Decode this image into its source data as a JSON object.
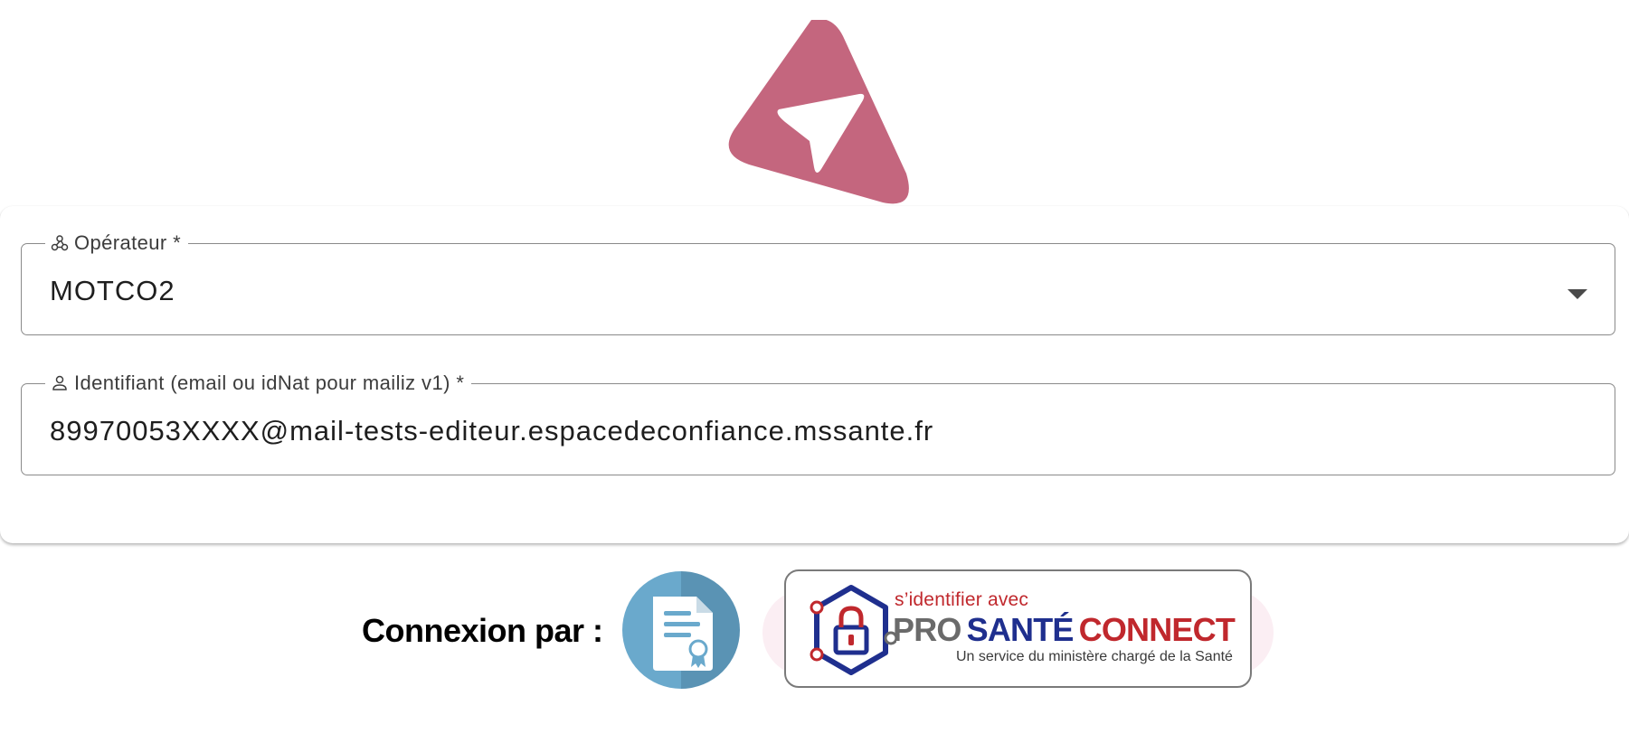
{
  "colors": {
    "brand_pink": "#c4667e",
    "field_border": "#8a8a8a",
    "cert_blue": "#6aa9cc",
    "psc_red": "#c0282d",
    "psc_navy": "#1f2f8e"
  },
  "form": {
    "operator": {
      "label": "Opérateur *",
      "icon": "webhook-icon",
      "value": "MOTCO2"
    },
    "identifier": {
      "label": "Identifiant (email ou idNat pour mailiz v1) *",
      "icon": "person-icon",
      "value": "89970053XXXX@mail-tests-editeur.espacedeconfiance.mssante.fr"
    }
  },
  "login": {
    "label": "Connexion par :",
    "certificate_icon": "certificate-icon",
    "psc": {
      "tagline": "s’identifier avec",
      "brand_pro": "PRO",
      "brand_sante": "SANTÉ",
      "brand_connect": "CONNECT",
      "subtitle": "Un service du ministère chargé de la Santé"
    }
  }
}
